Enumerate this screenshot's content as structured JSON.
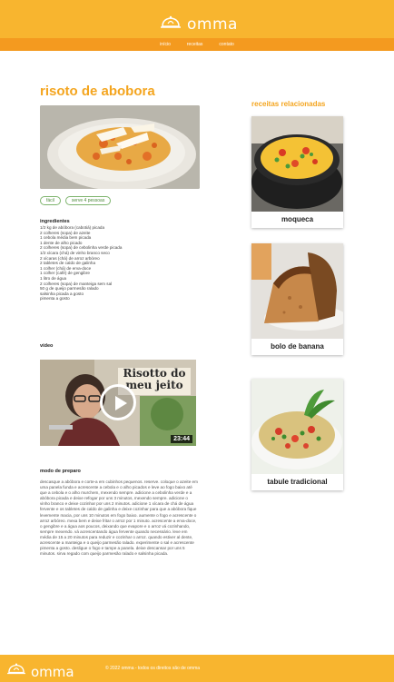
{
  "header": {
    "brand": "omma",
    "nav": [
      "início",
      "receitas",
      "contato"
    ]
  },
  "recipe": {
    "title": "risoto de abobora",
    "hero_icon": "risotto-dish-image",
    "tags": [
      "fácil",
      "serve 4 pessoas"
    ],
    "ingredients_title": "ingredientes",
    "ingredients": [
      "1/2 kg de abóbora (cabotiá) picada",
      "2 colheres (sopa) de azeite",
      "1 cebola média bem picada",
      "1 dente de alho picado",
      "2 colheres (sopa) de cebolinha verde picada",
      "1/2 xícara (chá) de vinho branco seco",
      "2 xícaras (chá) de arroz arbóreo",
      "2 tabletes de caldo de galinha",
      "1 colher (chá) de erva-doce",
      "1 colher (café) de gengibre",
      "1 litro de água",
      "2 colheres (sopa) de manteiga sem sal",
      "50 g de queijo parmesão ralado",
      "salsinha picada a gosto",
      "pimenta a gosto"
    ],
    "video_title": "vídeo",
    "video": {
      "caption_line1": "Risotto do",
      "caption_line2": "meu jeito",
      "duration": "23:44"
    },
    "prep_title": "modo de preparo",
    "prep_text": "descasque a abóbora e corte-a em cubinhos pequenos. reserve. coloque o azeite em uma panela funda e acrescente a cebola e o alho picados e leve ao fogo baixo até que a cebola e o alho murchem, mexendo sempre. adicione a cebolinha verde e a abóbora picada e deixe refogar por uns 3 minutos, mexendo sempre. adicione o vinho branco e deixe cozinhar por uns 2 minutos. adicione 1 xícara de chá de água fervente e os tabletes de caldo de galinha e deixe cozinhar para que a abóbora fique levemente macia, por uns 10 minutos em fogo baixo. aumente o fogo e acrescente o arroz arbóreo. mexa bem e deixe fritar o arroz por 1 minuto. acrescente a erva-doce, o gengibre e a água aos poucos, deixando que evapore e o arroz vá cozinhando, sempre mexendo. vá acrescentando água fervente quando necessário. leve em média de 15 a 20 minutos para reduzir e cozinhar o arroz. quando estiver al dente, acrescente a manteiga e o queijo parmesão ralado. experimente o sal e acrescente pimenta a gosto. desligue o fogo e tampe a panela. deixe descansar por uns 5 minutos. sirva regado com queijo parmesão ralado e salsinha picada."
  },
  "related": {
    "title": "receitas relacionadas",
    "items": [
      {
        "label": "moqueca",
        "image_icon": "moqueca-pot-image"
      },
      {
        "label": "bolo de banana",
        "image_icon": "banana-cake-image"
      },
      {
        "label": "tabule tradicional",
        "image_icon": "tabbouleh-salad-image"
      }
    ]
  },
  "footer": {
    "brand": "omma",
    "copyright": "© 2022 omma - todos os direitos são de omma"
  },
  "colors": {
    "header_yellow": "#f8b52f",
    "nav_orange": "#f49a1f",
    "title_orange": "#f4a51f",
    "tag_green": "#4d8a3a"
  }
}
